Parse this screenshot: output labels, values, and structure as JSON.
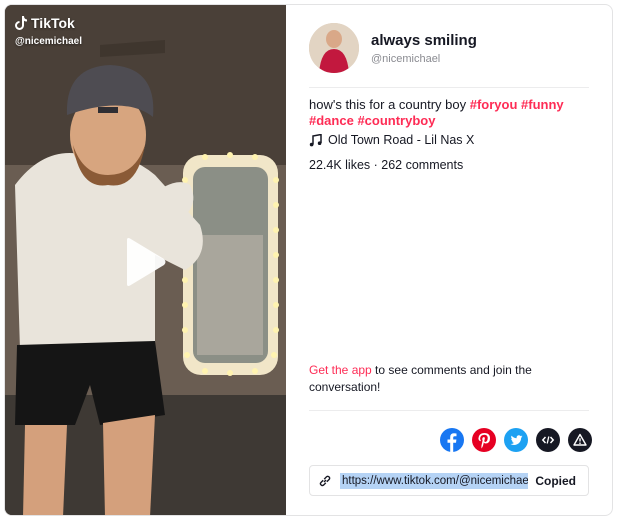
{
  "brand": {
    "name": "TikTok",
    "handle": "@nicemichael"
  },
  "author": {
    "display_name": "always smiling",
    "handle": "@nicemichael"
  },
  "caption": {
    "text": "how's this for a country boy ",
    "hashtags": [
      "#foryou",
      "#funny",
      "#dance",
      "#countryboy"
    ]
  },
  "music": {
    "label": "Old Town Road - Lil Nas X",
    "icon": "music-note-icon"
  },
  "stats": {
    "text": "22.4K likes · 262 comments"
  },
  "get_app": {
    "link_text": "Get the app",
    "rest_text": " to see comments and join the conversation!"
  },
  "share": {
    "buttons": [
      {
        "name": "facebook-share-button",
        "icon": "facebook-icon",
        "color": "#1877f2"
      },
      {
        "name": "pinterest-share-button",
        "icon": "pinterest-icon",
        "color": "#e60023"
      },
      {
        "name": "twitter-share-button",
        "icon": "twitter-icon",
        "color": "#1da1f2"
      },
      {
        "name": "embed-button",
        "icon": "embed-code-icon",
        "color": "#161823"
      },
      {
        "name": "report-button",
        "icon": "warning-icon",
        "color": "#161823"
      }
    ]
  },
  "copy_link": {
    "url": "https://www.tiktok.com/@nicemichael/",
    "status": "Copied"
  },
  "colors": {
    "accent": "#fe2c55",
    "text": "#161823",
    "muted": "#8a8b91"
  }
}
